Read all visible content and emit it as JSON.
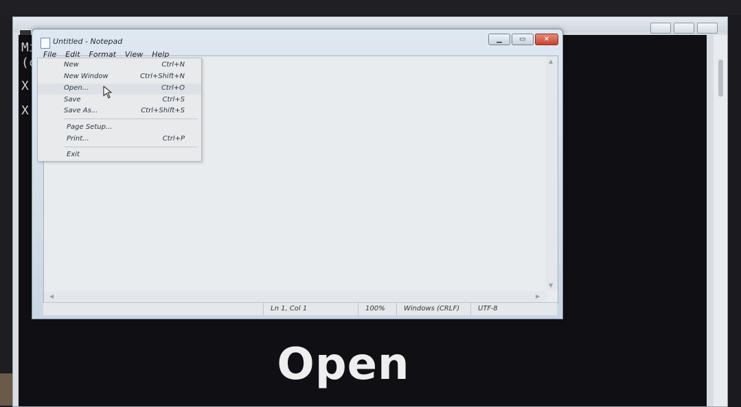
{
  "console": {
    "icon": "console-icon",
    "lines": [
      "Mi",
      "(c",
      "X:",
      "X:"
    ]
  },
  "notepad": {
    "title": "Untitled - Notepad",
    "menu": [
      "File",
      "Edit",
      "Format",
      "View",
      "Help"
    ],
    "status": {
      "position": "Ln 1, Col 1",
      "zoom": "100%",
      "line_ending": "Windows (CRLF)",
      "encoding": "UTF-8"
    }
  },
  "file_menu": {
    "items": [
      {
        "label": "New",
        "shortcut": "Ctrl+N"
      },
      {
        "label": "New Window",
        "shortcut": "Ctrl+Shift+N"
      },
      {
        "label": "Open...",
        "shortcut": "Ctrl+O"
      },
      {
        "label": "Save",
        "shortcut": "Ctrl+S"
      },
      {
        "label": "Save As...",
        "shortcut": "Ctrl+Shift+S"
      },
      {
        "label": "Page Setup...",
        "shortcut": ""
      },
      {
        "label": "Print...",
        "shortcut": "Ctrl+P"
      },
      {
        "label": "Exit",
        "shortcut": ""
      }
    ],
    "hovered": "Open..."
  },
  "caption": "Open",
  "colors": {
    "console_bg": "#101014",
    "close_button": "#c6452f",
    "caption_text": "#eeeeee"
  }
}
